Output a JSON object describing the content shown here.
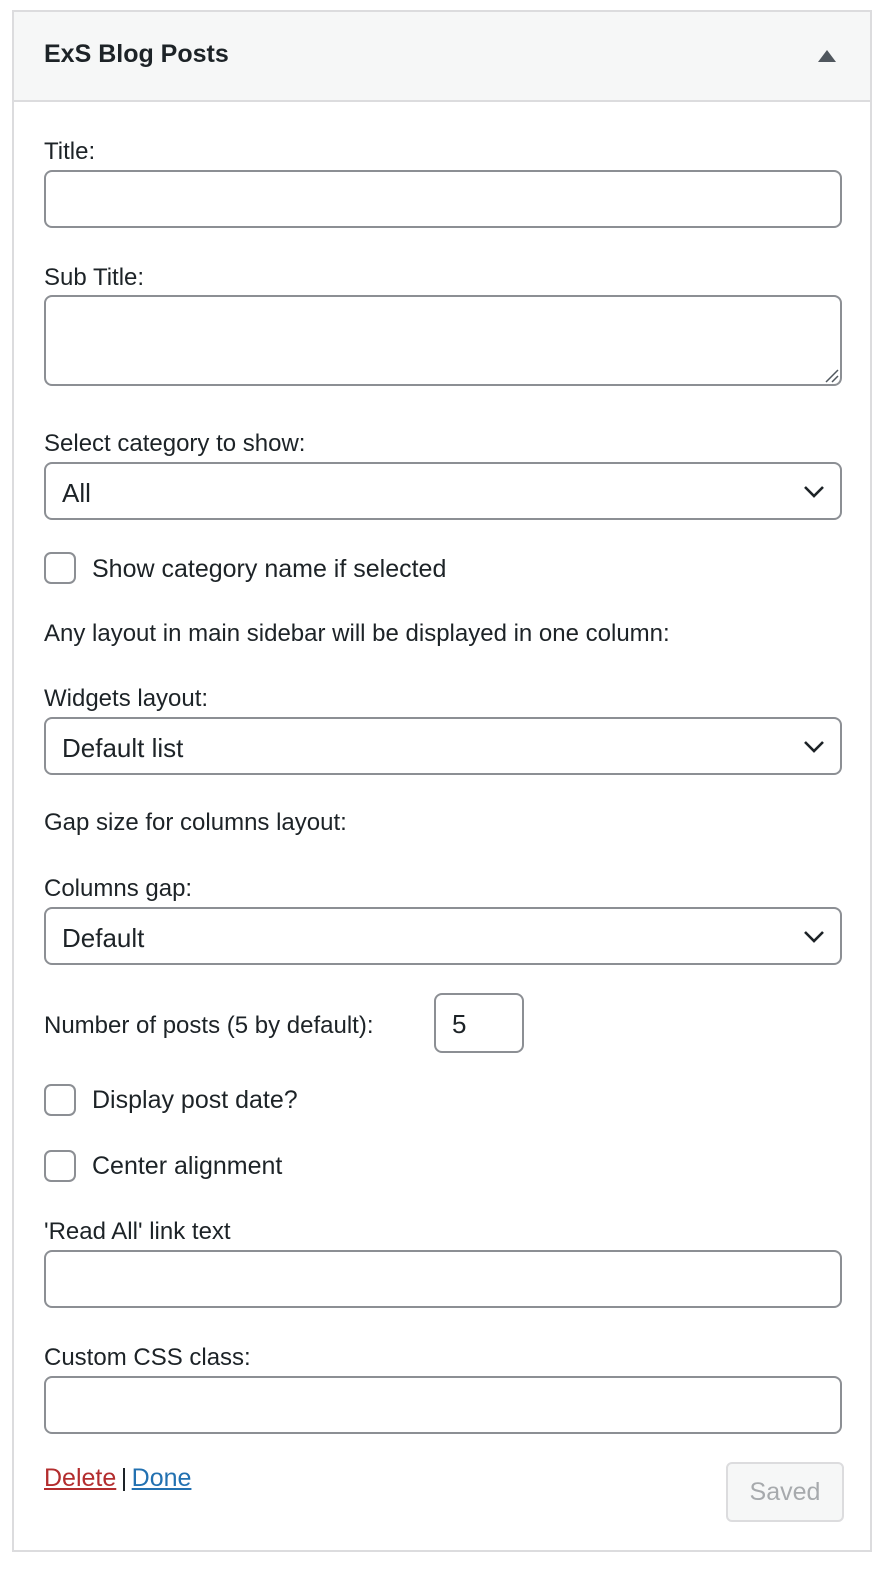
{
  "widget": {
    "title": "ExS Blog Posts",
    "toggle_icon": "triangle-up-icon"
  },
  "form": {
    "title_label": "Title:",
    "title_value": "",
    "subtitle_label": "Sub Title:",
    "subtitle_value": "",
    "category_label": "Select category to show:",
    "category_selected": "All",
    "show_category_name_label": "Show category name if selected",
    "show_category_name_checked": false,
    "layout_note": "Any layout in main sidebar will be displayed in one column:",
    "widgets_layout_label": "Widgets layout:",
    "widgets_layout_selected": "Default list",
    "gap_note": "Gap size for columns layout:",
    "columns_gap_label": "Columns gap:",
    "columns_gap_selected": "Default",
    "number_posts_label": "Number of posts (5 by default):",
    "number_posts_value": "5",
    "display_date_label": "Display post date?",
    "display_date_checked": false,
    "center_alignment_label": "Center alignment",
    "center_alignment_checked": false,
    "read_all_label": "'Read All' link text",
    "read_all_value": "",
    "css_class_label": "Custom CSS class:",
    "css_class_value": ""
  },
  "footer": {
    "delete_label": "Delete",
    "separator": "|",
    "done_label": "Done",
    "saved_label": "Saved"
  },
  "colors": {
    "delete_link": "#b32d2e",
    "done_link": "#2271b1",
    "border": "#8c8f94",
    "header_bg": "#f6f7f7"
  }
}
